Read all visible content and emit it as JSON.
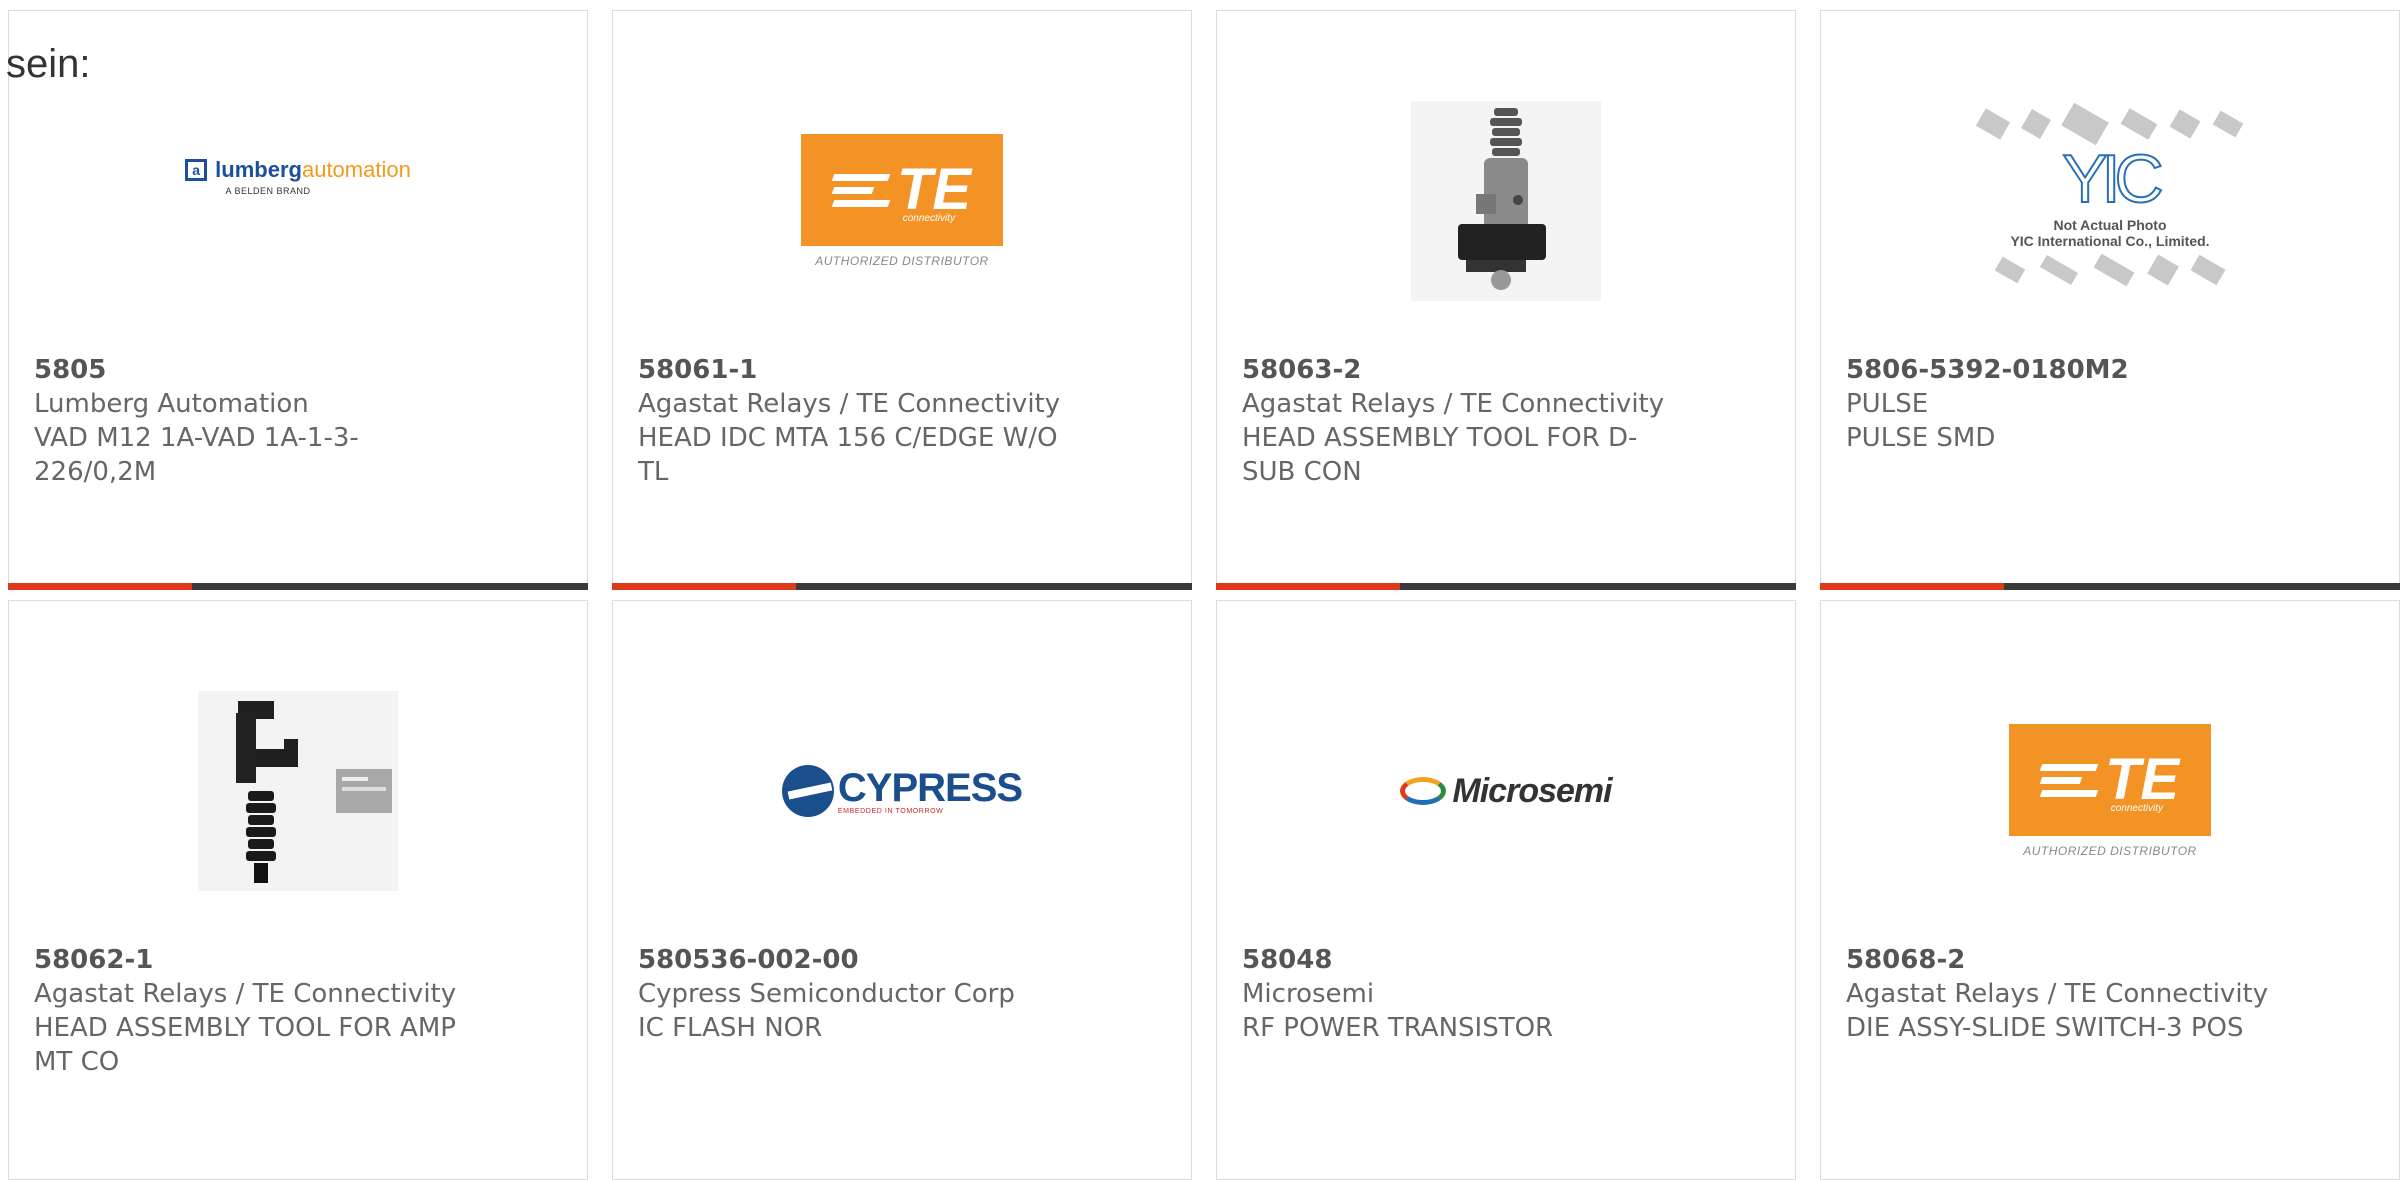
{
  "lead_text": "sein:",
  "products": [
    {
      "part_number": "5805",
      "manufacturer": "Lumberg Automation",
      "description": "VAD M12 1A-VAD 1A-1-3-226/0,2M",
      "image": "lumberg-automation-logo",
      "logo": {
        "name1": "lumberg",
        "name2": "automation",
        "sub": "A BELDEN BRAND"
      }
    },
    {
      "part_number": "58061-1",
      "manufacturer": "Agastat Relays / TE Connectivity",
      "description": "HEAD IDC MTA 156 C/EDGE W/O TL",
      "image": "te-connectivity-logo",
      "logo": {
        "letters": "TE",
        "conn": "connectivity",
        "dist": "AUTHORIZED DISTRIBUTOR"
      }
    },
    {
      "part_number": "58063-2",
      "manufacturer": "Agastat Relays / TE Connectivity",
      "description": "HEAD ASSEMBLY TOOL FOR D-SUB CON",
      "image": "head-assembly-tool-photo"
    },
    {
      "part_number": "5806-5392-0180M2",
      "manufacturer": "PULSE",
      "description": "PULSE SMD",
      "image": "yic-placeholder",
      "logo": {
        "mark": "YIC",
        "line1": "Not Actual Photo",
        "line2": "YIC International Co., Limited."
      }
    },
    {
      "part_number": "58062-1",
      "manufacturer": "Agastat Relays / TE Connectivity",
      "description": "HEAD ASSEMBLY TOOL FOR AMP MT CO",
      "image": "crimp-head-tool-photo"
    },
    {
      "part_number": "580536-002-00",
      "manufacturer": "Cypress Semiconductor Corp",
      "description": "IC FLASH NOR",
      "image": "cypress-logo",
      "logo": {
        "name": "CYPRESS",
        "tag": "EMBEDDED IN TOMORROW"
      }
    },
    {
      "part_number": "58048",
      "manufacturer": "Microsemi",
      "description": "RF POWER TRANSISTOR",
      "image": "microsemi-logo",
      "logo": {
        "name": "Microsemi"
      }
    },
    {
      "part_number": "58068-2",
      "manufacturer": "Agastat Relays / TE Connectivity",
      "description": "DIE ASSY-SLIDE SWITCH-3 POS",
      "image": "te-connectivity-logo",
      "logo": {
        "letters": "TE",
        "conn": "connectivity",
        "dist": "AUTHORIZED DISTRIBUTOR"
      }
    }
  ],
  "colors": {
    "accent": "#e0391c",
    "bar": "#3a3a3a",
    "border": "#dcdcdc",
    "text": "#666666"
  }
}
